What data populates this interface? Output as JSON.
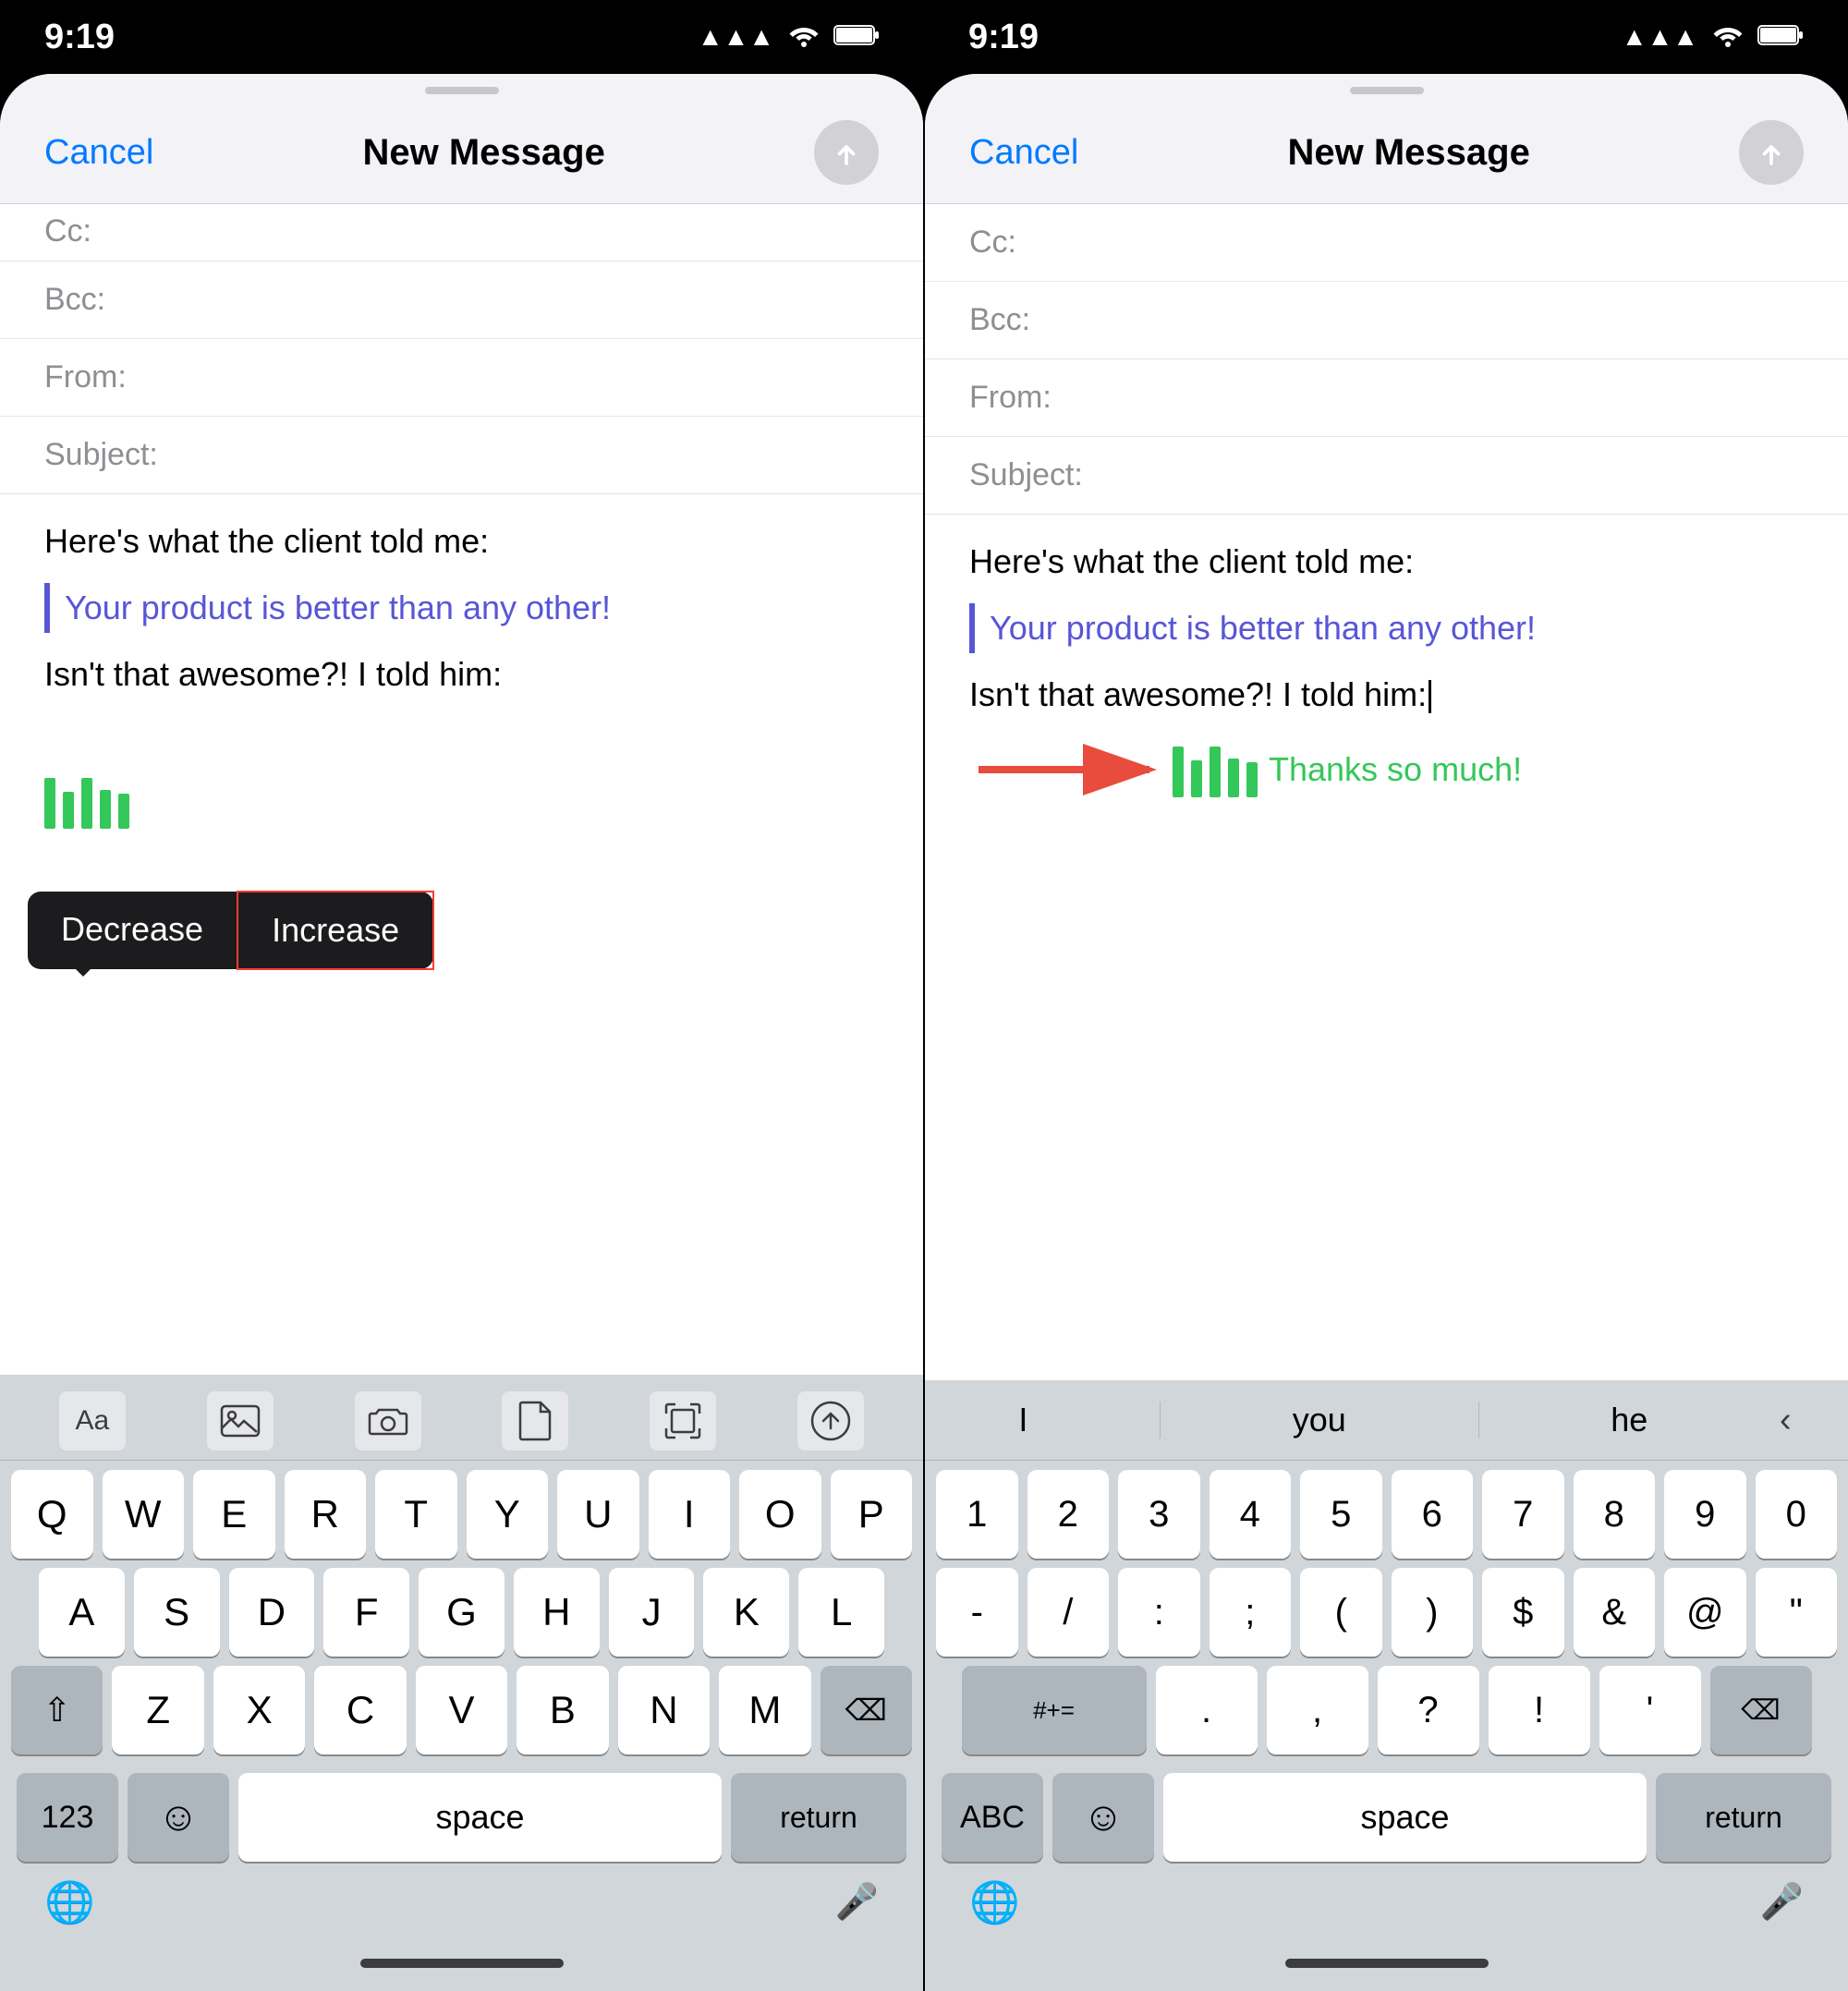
{
  "status": {
    "time": "9:19",
    "signal": "▲▲▲",
    "wifi": "wifi",
    "battery": "battery"
  },
  "left_panel": {
    "nav": {
      "cancel": "Cancel",
      "title": "New Message"
    },
    "fields": {
      "bcc_label": "Bcc:",
      "from_label": "From:",
      "subject_label": "Subject:"
    },
    "body_text1": "Here's what the client told me:",
    "body_quote": "Your product is better than any other!",
    "body_text2": "Isn't that awesome?! I told him:",
    "tooltip": {
      "decrease": "Decrease",
      "increase": "Increase"
    },
    "keyboard": {
      "toolbar_text": "Aa",
      "row1": [
        "Q",
        "W",
        "E",
        "R",
        "T",
        "Y",
        "U",
        "I",
        "O",
        "P"
      ],
      "row2": [
        "A",
        "S",
        "D",
        "F",
        "G",
        "H",
        "J",
        "K",
        "L"
      ],
      "row3": [
        "Z",
        "X",
        "C",
        "V",
        "B",
        "N",
        "M"
      ],
      "bottom": {
        "num": "123",
        "emoji": "☺",
        "space": "space",
        "return": "return"
      }
    }
  },
  "right_panel": {
    "nav": {
      "cancel": "Cancel",
      "title": "New Message"
    },
    "fields": {
      "cc_label": "Cc:",
      "bcc_label": "Bcc:",
      "from_label": "From:",
      "subject_label": "Subject:"
    },
    "body_text1": "Here's what the client told me:",
    "body_quote": "Your product is better than any other!",
    "body_text2": "Isn't that awesome?! I told him:",
    "thanks_text": "Thanks so much!",
    "keyboard": {
      "suggestions": [
        "I",
        "you",
        "he"
      ],
      "row1": [
        "1",
        "2",
        "3",
        "4",
        "5",
        "6",
        "7",
        "8",
        "9",
        "0"
      ],
      "row2": [
        "-",
        "/",
        ":",
        ";",
        "(",
        ")",
        "$",
        "&",
        "@",
        "\""
      ],
      "row3": [
        "#+=",
        ".",
        ",",
        "?",
        "!",
        "'"
      ],
      "bottom": {
        "abc": "ABC",
        "emoji": "☺",
        "space": "space",
        "return": "return"
      }
    }
  }
}
